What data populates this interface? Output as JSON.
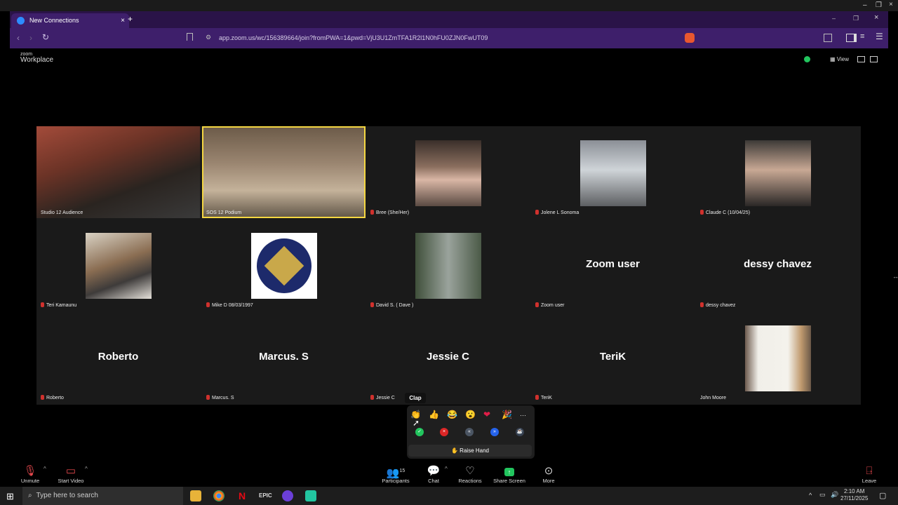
{
  "browser": {
    "tab_title": "New Connections",
    "tab_close": "×",
    "new_tab": "+",
    "url": "app.zoom.us/wc/156389664/join?fromPWA=1&pwd=VjU3U1ZmTFA1R2l1N0hFU0ZJN0FwUT09",
    "win_min": "–",
    "win_max": "❐",
    "win_close": "×"
  },
  "zoom": {
    "logo_small": "zoom",
    "logo_big": "Workplace",
    "view_label": "View"
  },
  "participants": [
    {
      "name": "Studio 12 Audience",
      "type": "video"
    },
    {
      "name": "SOS 12 Podium",
      "type": "video"
    },
    {
      "name": "Bree (She/Her)",
      "type": "photo"
    },
    {
      "name": "Jolene L Sonoma",
      "type": "photo"
    },
    {
      "name": "Claude C (10/04/25)",
      "type": "photo"
    },
    {
      "name": "Teri Kamaunu",
      "type": "photo"
    },
    {
      "name": "Mike D 08/03/1997",
      "type": "photo"
    },
    {
      "name": "David S. ( Dave )",
      "type": "photo"
    },
    {
      "name": "Zoom user",
      "type": "name",
      "display": "Zoom user"
    },
    {
      "name": "dessy chavez",
      "type": "name",
      "display": "dessy chavez"
    },
    {
      "name": "Roberto",
      "type": "name",
      "display": "Roberto"
    },
    {
      "name": "Marcus. S",
      "type": "name",
      "display": "Marcus. S"
    },
    {
      "name": "Jessie C",
      "type": "name",
      "display": "Jessie C"
    },
    {
      "name": "TeriK",
      "type": "name",
      "display": "TeriK"
    },
    {
      "name": "John Moore",
      "type": "photo"
    }
  ],
  "reactions": {
    "tooltip": "Clap",
    "emojis": [
      "👏",
      "👍",
      "😂",
      "😮",
      "❤",
      "🎉",
      "···"
    ],
    "raise_hand": "✋ Raise Hand"
  },
  "toolbar": {
    "unmute": "Unmute",
    "start_video": "Start Video",
    "participants": "Participants",
    "participants_count": "15",
    "chat": "Chat",
    "reactions": "Reactions",
    "share_screen": "Share Screen",
    "more": "More",
    "leave": "Leave"
  },
  "taskbar": {
    "search_placeholder": "Type here to search",
    "time": "2:10 AM",
    "date": "27/11/2025"
  }
}
